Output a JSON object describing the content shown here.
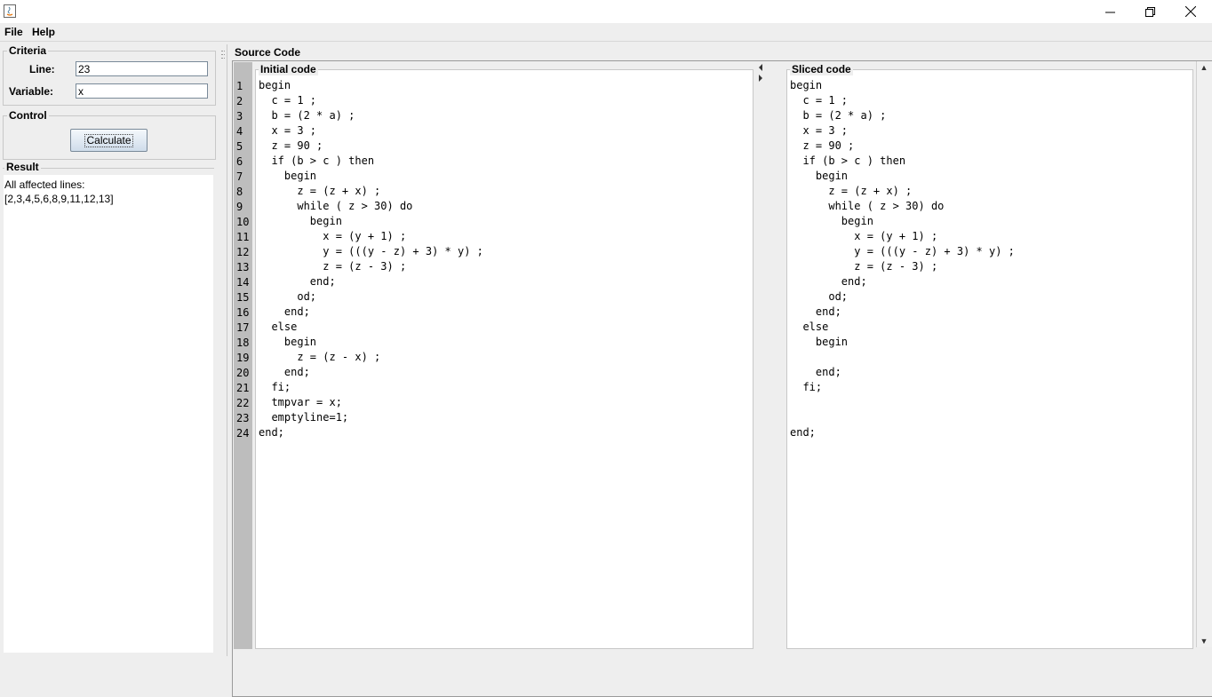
{
  "window": {
    "minimize_icon": "minimize-icon",
    "maximize_icon": "restore-icon",
    "close_icon": "close-icon"
  },
  "menu": {
    "file": "File",
    "help": "Help"
  },
  "criteria": {
    "title": "Criteria",
    "line_label": "Line:",
    "line_value": "23",
    "variable_label": "Variable:",
    "variable_value": "x"
  },
  "control": {
    "title": "Control",
    "calculate": "Calculate"
  },
  "result": {
    "title": "Result",
    "lines": [
      "All affected lines:",
      "[2,3,4,5,6,8,9,11,12,13]"
    ]
  },
  "source": {
    "title": "Source Code",
    "initial_title": "Initial code",
    "sliced_title": "Sliced code",
    "line_numbers": [
      "1",
      "2",
      "3",
      "4",
      "5",
      "6",
      "7",
      "8",
      "9",
      "10",
      "11",
      "12",
      "13",
      "14",
      "15",
      "16",
      "17",
      "18",
      "19",
      "20",
      "21",
      "22",
      "23",
      "24"
    ],
    "initial_code": [
      "begin",
      "  c = 1 ;",
      "  b = (2 * a) ;",
      "  x = 3 ;",
      "  z = 90 ;",
      "  if (b > c ) then",
      "    begin",
      "      z = (z + x) ;",
      "      while ( z > 30) do",
      "        begin",
      "          x = (y + 1) ;",
      "          y = (((y - z) + 3) * y) ;",
      "          z = (z - 3) ;",
      "        end;",
      "      od;",
      "    end;",
      "  else",
      "    begin",
      "      z = (z - x) ;",
      "    end;",
      "  fi;",
      "  tmpvar = x;",
      "  emptyline=1;",
      "end;"
    ],
    "sliced_code": [
      "begin",
      "  c = 1 ;",
      "  b = (2 * a) ;",
      "  x = 3 ;",
      "  z = 90 ;",
      "  if (b > c ) then",
      "    begin",
      "      z = (z + x) ;",
      "      while ( z > 30) do",
      "        begin",
      "          x = (y + 1) ;",
      "          y = (((y - z) + 3) * y) ;",
      "          z = (z - 3) ;",
      "        end;",
      "      od;",
      "    end;",
      "  else",
      "    begin",
      "",
      "    end;",
      "  fi;",
      "",
      "",
      "end;"
    ]
  },
  "colors": {
    "gutter": "#bdbdbd",
    "panel_bg": "#eeeeee",
    "button_top": "#f4f8fc",
    "button_bottom": "#cfdcea"
  }
}
